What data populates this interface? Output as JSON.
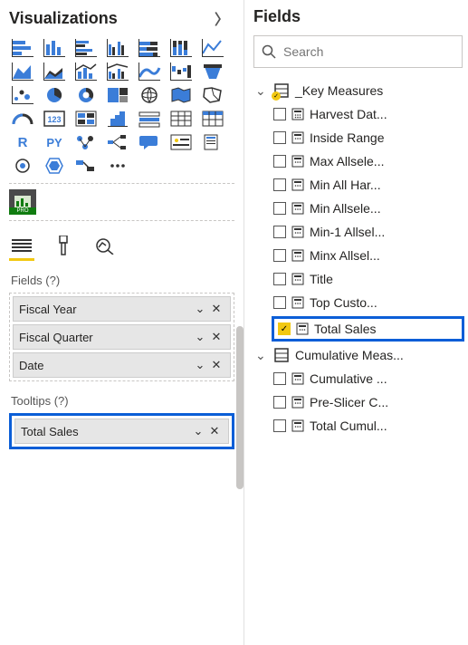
{
  "visualizations": {
    "title": "Visualizations"
  },
  "wells": {
    "fieldsLabel": "Fields (?)",
    "fields": [
      {
        "label": "Fiscal Year"
      },
      {
        "label": "Fiscal Quarter"
      },
      {
        "label": "Date"
      }
    ],
    "tooltipsLabel": "Tooltips (?)",
    "tooltips": [
      {
        "label": "Total Sales"
      }
    ]
  },
  "fieldsPane": {
    "title": "Fields",
    "searchPlaceholder": "Search",
    "groups": [
      {
        "name": "_Key Measures",
        "expanded": true,
        "items": [
          {
            "label": "Harvest Dat...",
            "checked": false
          },
          {
            "label": "Inside Range",
            "checked": false
          },
          {
            "label": "Max Allsele...",
            "checked": false
          },
          {
            "label": "Min All Har...",
            "checked": false
          },
          {
            "label": "Min Allsele...",
            "checked": false
          },
          {
            "label": "Min-1 Allsel...",
            "checked": false
          },
          {
            "label": "Minx Allsel...",
            "checked": false
          },
          {
            "label": "Title",
            "checked": false
          },
          {
            "label": "Top Custo...",
            "checked": false
          },
          {
            "label": "Total Sales",
            "checked": true,
            "highlight": true
          }
        ]
      },
      {
        "name": "Cumulative Meas...",
        "expanded": true,
        "items": [
          {
            "label": "Cumulative ...",
            "checked": false
          },
          {
            "label": "Pre-Slicer C...",
            "checked": false
          },
          {
            "label": "Total Cumul...",
            "checked": false
          }
        ]
      }
    ]
  },
  "vizIcons": [
    "stacked-bar",
    "stacked-column",
    "clustered-bar",
    "clustered-column",
    "100-bar",
    "100-column",
    "line",
    "area",
    "stacked-area",
    "line-stacked",
    "line-clustered",
    "ribbon",
    "waterfall",
    "scatter",
    "pie",
    "donut",
    "treemap",
    "map",
    "filled-map",
    "funnel",
    "gauge",
    "card",
    "multi-card",
    "kpi",
    "slicer",
    "table",
    "matrix",
    "r-visual",
    "py-visual",
    "key-influencers",
    "decomp-tree",
    "qa",
    "paginated",
    "arcgis",
    "more"
  ],
  "rpy": {
    "r": "R",
    "py": "PY"
  }
}
